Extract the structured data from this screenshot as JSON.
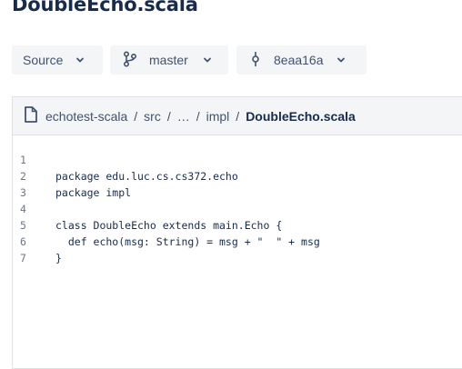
{
  "page": {
    "title": "DoubleEcho.scala"
  },
  "toolbar": {
    "source_label": "Source",
    "branch_label": "master",
    "commit_label": "8eaa16a"
  },
  "breadcrumb": {
    "items": [
      "echotest-scala",
      "src",
      "…",
      "impl",
      "DoubleEcho.scala"
    ],
    "separator": "/"
  },
  "code": {
    "lines": [
      {
        "num": "1",
        "text": "package edu.luc.cs.cs372.echo"
      },
      {
        "num": "2",
        "text": "package impl"
      },
      {
        "num": "3",
        "text": ""
      },
      {
        "num": "4",
        "text": "class DoubleEcho extends main.Echo {"
      },
      {
        "num": "5",
        "text": "  def echo(msg: String) = msg + \"  \" + msg"
      },
      {
        "num": "6",
        "text": "}"
      },
      {
        "num": "7",
        "text": ""
      }
    ]
  },
  "icons": {
    "source": "chevron-down-icon",
    "branch": "branch-icon",
    "commit": "commit-icon",
    "file": "file-icon"
  }
}
